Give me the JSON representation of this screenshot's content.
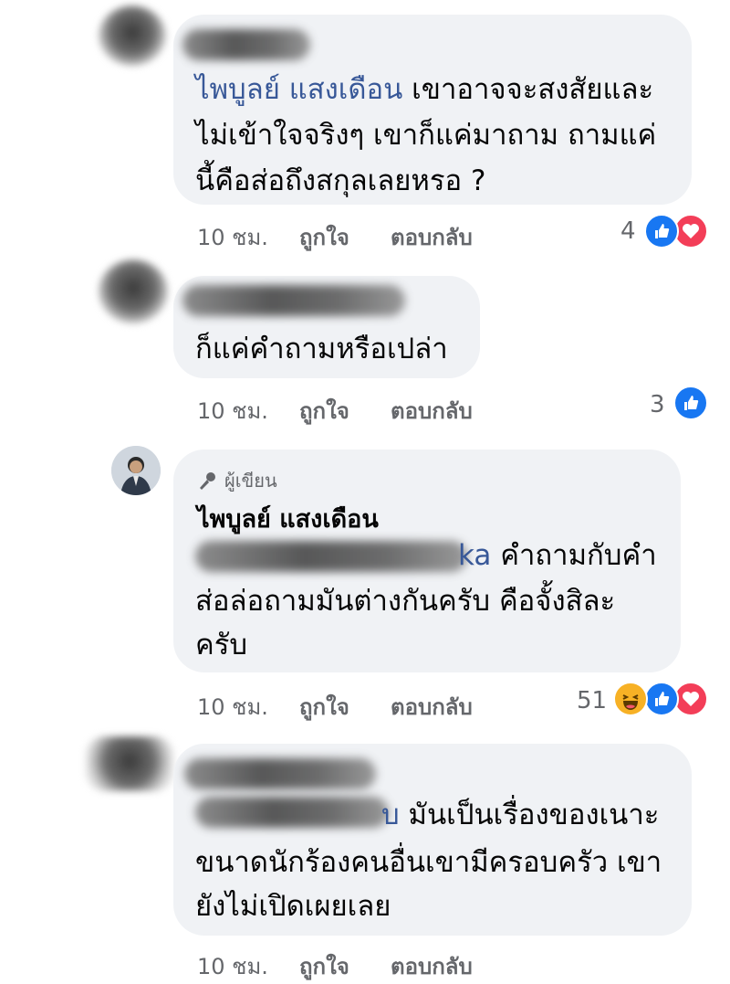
{
  "comments": [
    {
      "name_link": "ไพบูลย์ แสงเดือน",
      "text_line1": "เขาอาจจะสงสัยและ",
      "text_line2": "ไม่เข้าใจจริงๆ เขาก็แค่มาถาม ถามแค่",
      "text_line3": "นี้คือส่อถึงสกุลเลยหรอ ?",
      "time": "10 ชม.",
      "like_label": "ถูกใจ",
      "reply_label": "ตอบกลับ",
      "reaction_count": "4"
    },
    {
      "text_line1": "ก็แค่คำถามหรือเปล่า",
      "time": "10 ชม.",
      "like_label": "ถูกใจ",
      "reply_label": "ตอบกลับ",
      "reaction_count": "3"
    },
    {
      "author_badge": "ผู้เขียน",
      "author_name": "ไพบูลย์ แสงเดือน",
      "mention_tail": "ka",
      "text_line1": "คำถามกับคำ",
      "text_line2": "ส่อล่อถามมันต่างกันครับ คือจั้งสิละ",
      "text_line3": "ครับ",
      "time": "10 ชม.",
      "like_label": "ถูกใจ",
      "reply_label": "ตอบกลับ",
      "reaction_count": "51"
    },
    {
      "mention_tail": "บ",
      "text_line1": "มันเป็นเรื่องของเนาะ",
      "text_line2": "ขนาดนักร้องคนอื่นเขามีครอบครัว เขา",
      "text_line3": "ยังไม่เปิดเผยเลย",
      "time": "10 ชม.",
      "like_label": "ถูกใจ",
      "reply_label": "ตอบกลับ"
    }
  ]
}
